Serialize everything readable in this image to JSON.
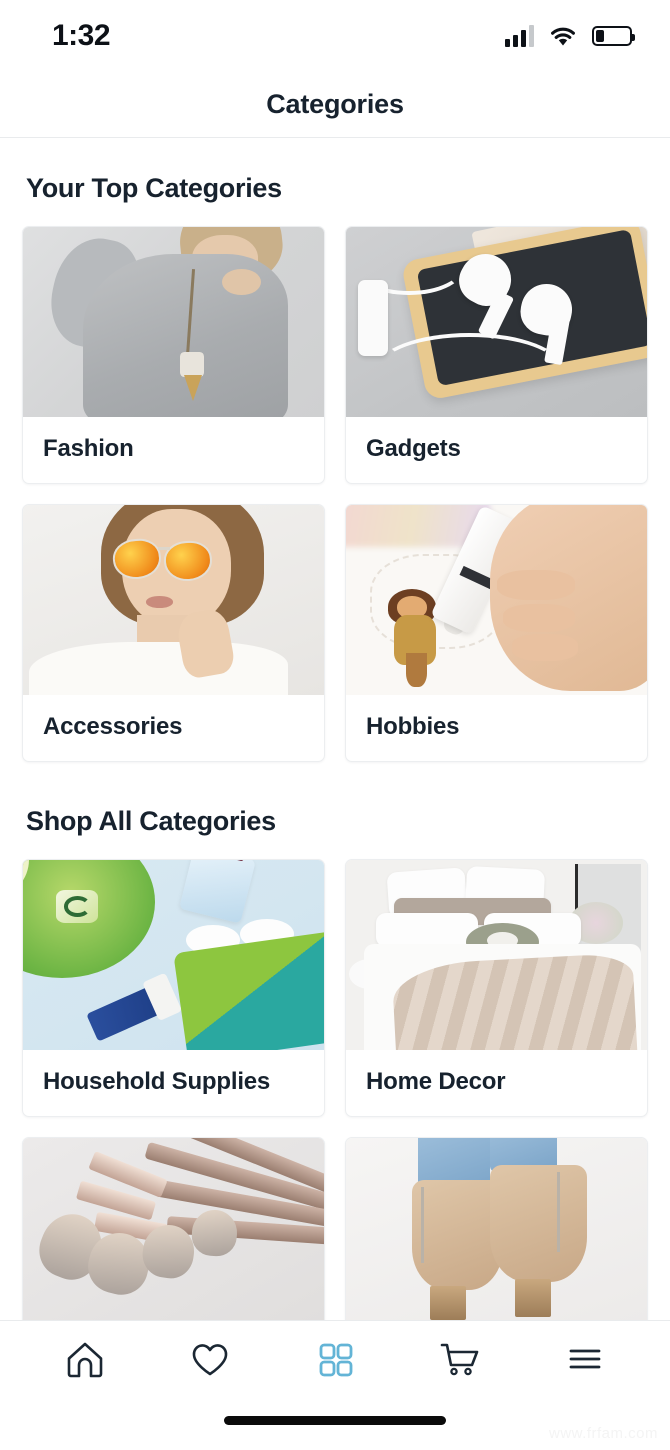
{
  "status_bar": {
    "time": "1:32",
    "signal_icon": "signal-bars-icon",
    "signal_bars_filled": 3,
    "signal_bars_total": 4,
    "wifi_icon": "wifi-icon",
    "battery_icon": "battery-icon",
    "battery_level_percent": 25
  },
  "header": {
    "title": "Categories"
  },
  "sections": [
    {
      "id": "top-categories",
      "title": "Your Top Categories",
      "cards": [
        {
          "label": "Fashion",
          "scene": "fashion",
          "clipped": false
        },
        {
          "label": "Gadgets",
          "scene": "gadgets",
          "clipped": false
        },
        {
          "label": "Accessories",
          "scene": "acc",
          "clipped": false
        },
        {
          "label": "Hobbies",
          "scene": "hob",
          "clipped": false
        }
      ]
    },
    {
      "id": "shop-all-categories",
      "title": "Shop All Categories",
      "cards": [
        {
          "label": "Household Supplies",
          "scene": "house",
          "clipped": false
        },
        {
          "label": "Home Decor",
          "scene": "home",
          "clipped": false
        },
        {
          "label": "",
          "scene": "brush",
          "clipped": true
        },
        {
          "label": "",
          "scene": "boot",
          "clipped": true
        }
      ]
    }
  ],
  "bottom_nav": {
    "active_index": 2,
    "active_color": "#63b4d6",
    "inactive_color": "#1b2733",
    "items": [
      {
        "name": "home-icon",
        "label": "Home"
      },
      {
        "name": "heart-icon",
        "label": "Favorites"
      },
      {
        "name": "grid-icon",
        "label": "Categories"
      },
      {
        "name": "cart-icon",
        "label": "Cart"
      },
      {
        "name": "hamburger-icon",
        "label": "Menu"
      }
    ]
  },
  "watermark": {
    "text": "www.frfam.com"
  },
  "theme": {
    "text_primary": "#17222e",
    "background": "#ffffff",
    "card_border": "#eceef0",
    "divider": "#e9ebed"
  }
}
